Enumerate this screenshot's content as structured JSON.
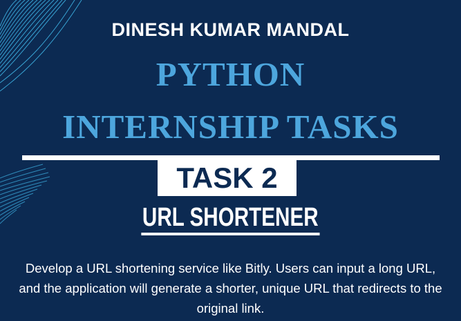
{
  "author": "DINESH KUMAR MANDAL",
  "headline": {
    "line1": "PYTHON",
    "line2": "INTERNSHIP TASKS"
  },
  "task_label": "TASK 2",
  "task_title": "URL SHORTENER",
  "description": "Develop a URL shortening service like Bitly. Users can input a long URL, and the application will generate a shorter, unique URL that redirects to the original link.",
  "colors": {
    "background": "#0c2a52",
    "headline": "#4da6dd",
    "text": "#ffffff",
    "wave_lines": "#3fb6e8"
  }
}
